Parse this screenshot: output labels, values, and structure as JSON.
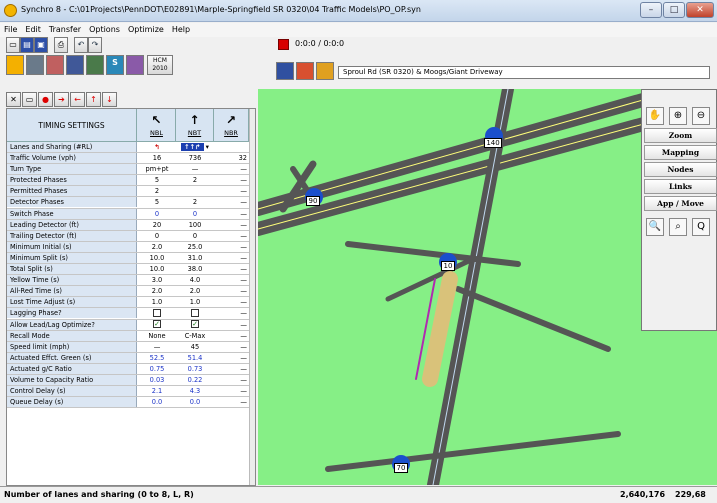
{
  "window": {
    "title": "Synchro 8 - C:\\01Projects\\PennDOT\\E02891\\Marple-Springfield SR 0320\\04 Traffic Models\\PO_OP.syn",
    "minimize": "–",
    "maximize": "□",
    "close": "✕"
  },
  "menu": [
    "File",
    "Edit",
    "Transfer",
    "Options",
    "Optimize",
    "Help"
  ],
  "toolbar": {
    "time_display": "0:0:0 / 0:0:0",
    "hcm_label": "HCM\n2010",
    "intersection": "Sproul Rd (SR 0320) & Moogs/Giant Driveway"
  },
  "grid": {
    "header": "TIMING SETTINGS",
    "movements": [
      {
        "label": "NBL",
        "arrow": "↖"
      },
      {
        "label": "NBT",
        "arrow": "↑"
      },
      {
        "label": "NBR",
        "arrow": "↗"
      }
    ],
    "rows": [
      {
        "label": "Lanes and Sharing (#RL)",
        "v1": "",
        "v2": "",
        "v3": ""
      },
      {
        "label": "Traffic Volume (vph)",
        "v1": "16",
        "v2": "736",
        "v3": "32"
      },
      {
        "label": "Turn Type",
        "v1": "pm+pt",
        "v2": "—",
        "v3": "—"
      },
      {
        "label": "Protected Phases",
        "v1": "5",
        "v2": "2",
        "v3": "—"
      },
      {
        "label": "Permitted Phases",
        "v1": "2",
        "v2": "",
        "v3": "—"
      },
      {
        "label": "Detector Phases",
        "v1": "5",
        "v2": "2",
        "v3": "—"
      },
      {
        "label": "Switch Phase",
        "v1": "0",
        "v2": "0",
        "v3": "—",
        "blue": true
      },
      {
        "label": "Leading Detector (ft)",
        "v1": "20",
        "v2": "100",
        "v3": "—"
      },
      {
        "label": "Trailing Detector (ft)",
        "v1": "0",
        "v2": "0",
        "v3": "—"
      },
      {
        "label": "Minimum Initial (s)",
        "v1": "2.0",
        "v2": "25.0",
        "v3": "—"
      },
      {
        "label": "Minimum Split (s)",
        "v1": "10.0",
        "v2": "31.0",
        "v3": "—"
      },
      {
        "label": "Total Split (s)",
        "v1": "10.0",
        "v2": "38.0",
        "v3": "—"
      },
      {
        "label": "Yellow Time (s)",
        "v1": "3.0",
        "v2": "4.0",
        "v3": "—"
      },
      {
        "label": "All-Red Time (s)",
        "v1": "2.0",
        "v2": "2.0",
        "v3": "—"
      },
      {
        "label": "Lost Time Adjust (s)",
        "v1": "1.0",
        "v2": "1.0",
        "v3": "—"
      },
      {
        "label": "Lagging Phase?",
        "v1": "",
        "v2": "",
        "v3": "—",
        "check": [
          false,
          false
        ]
      },
      {
        "label": "Allow Lead/Lag Optimize?",
        "v1": "",
        "v2": "",
        "v3": "—",
        "check": [
          true,
          true
        ]
      },
      {
        "label": "Recall Mode",
        "v1": "None",
        "v2": "C-Max",
        "v3": "—"
      },
      {
        "label": "Speed limit (mph)",
        "v1": "—",
        "v2": "45",
        "v3": "—"
      },
      {
        "label": "Actuated Effct. Green (s)",
        "v1": "52.5",
        "v2": "51.4",
        "v3": "—",
        "blue": true
      },
      {
        "label": "Actuated g/C Ratio",
        "v1": "0.75",
        "v2": "0.73",
        "v3": "—",
        "blue": true
      },
      {
        "label": "Volume to Capacity Ratio",
        "v1": "0.03",
        "v2": "0.22",
        "v3": "—",
        "blue": true
      },
      {
        "label": "Control Delay (s)",
        "v1": "2.1",
        "v2": "4.3",
        "v3": "—",
        "blue": true
      },
      {
        "label": "Queue Delay (s)",
        "v1": "0.0",
        "v2": "0.0",
        "v3": "—",
        "blue": true
      }
    ]
  },
  "map": {
    "node_labels": [
      "140",
      "90",
      "10",
      "70"
    ]
  },
  "panel": {
    "buttons": [
      "Zoom",
      "Mapping",
      "Nodes",
      "Links",
      "App / Move"
    ],
    "icons": [
      "hand",
      "zoom-in",
      "zoom-out",
      "zoom-all",
      "zoom-window",
      "zoom-scale"
    ]
  },
  "status": {
    "text": "Number of lanes and sharing (0 to 8, L, R)",
    "x": "2,640,176",
    "y": "229,68"
  }
}
